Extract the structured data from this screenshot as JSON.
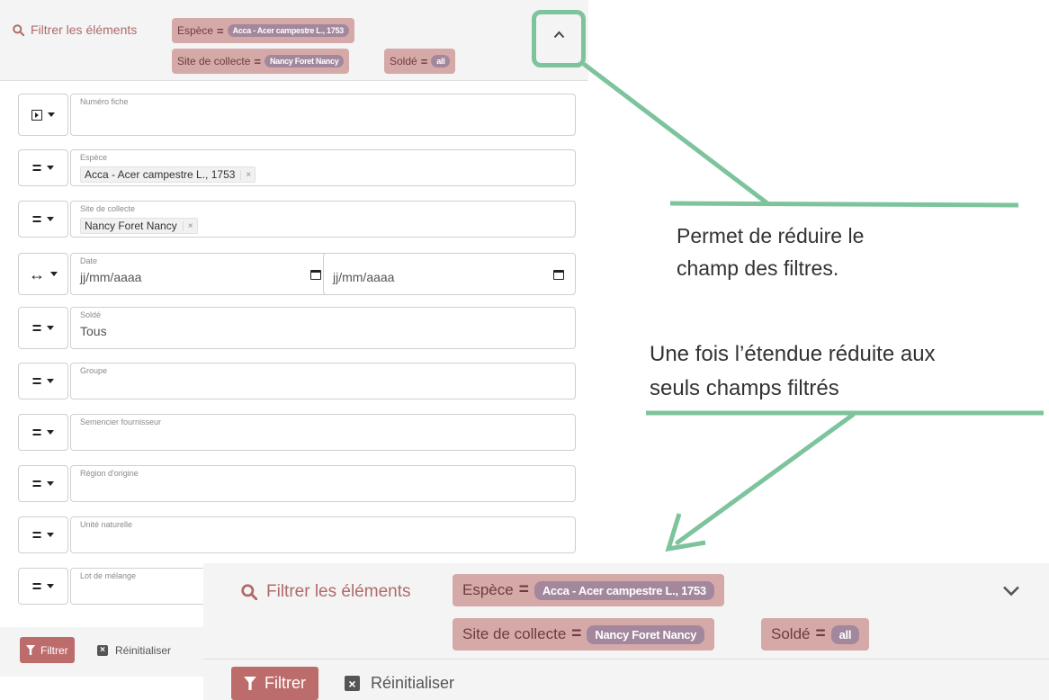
{
  "filter_bar": {
    "title": "Filtrer les éléments",
    "chips": [
      {
        "field": "Espèce",
        "operator": "=",
        "value": "Acca - Acer campestre L., 1753"
      },
      {
        "field": "Site de collecte",
        "operator": "=",
        "value": "Nancy Foret Nancy"
      },
      {
        "field": "Soldé",
        "operator": "=",
        "value": "all"
      }
    ],
    "toggle_icon": "chevron-up-icon"
  },
  "fields": [
    {
      "label": "Numéro fiche",
      "operator_icon": "play-box-icon",
      "value": ""
    },
    {
      "label": "Espèce",
      "operator": "=",
      "tag": "Acca - Acer campestre L., 1753",
      "tag_remove": "×"
    },
    {
      "label": "Site de collecte",
      "operator": "=",
      "tag": "Nancy Foret Nancy",
      "tag_remove": "×"
    },
    {
      "label": "Date",
      "operator": "↔",
      "from_placeholder": "jj/mm/aaaa",
      "to_placeholder": "jj/mm/aaaa"
    },
    {
      "label": "Soldé",
      "operator": "=",
      "value": "Tous"
    },
    {
      "label": "Groupe",
      "operator": "=",
      "value": ""
    },
    {
      "label": "Semencier fournisseur",
      "operator": "=",
      "value": ""
    },
    {
      "label": "Région d'origine",
      "operator": "=",
      "value": ""
    },
    {
      "label": "Unité naturelle",
      "operator": "=",
      "value": ""
    },
    {
      "label": "Lot de mélange",
      "operator": "=",
      "value": ""
    }
  ],
  "actions": {
    "filter_label": "Filtrer",
    "reset_label": "Réinitialiser",
    "reset_icon_glyph": "×"
  },
  "annotations": {
    "note1_line1": "Permet de réduire le",
    "note1_line2": "champ des filtres.",
    "note2_line1": "Une fois l’étendue réduite aux",
    "note2_line2": "seuls champs filtrés"
  },
  "collapsed_view": {
    "title": "Filtrer les éléments",
    "toggle_icon": "chevron-down-icon"
  },
  "colors": {
    "accent_green": "#7dc49c",
    "chip_bg": "#d6a9a9",
    "chip_pill": "#a3889d",
    "filter_button": "#bd6c6c",
    "title_text": "#b06a6a"
  }
}
